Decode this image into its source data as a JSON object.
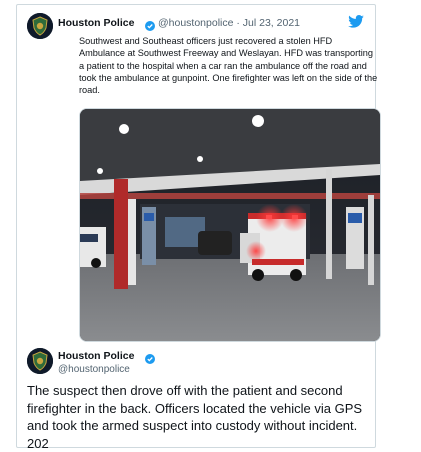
{
  "tweet1": {
    "name": "Houston Police",
    "handle_date": "@houstonpolice · Jul 23, 2021",
    "text": "Southwest and Southeast officers just recovered a stolen HFD Ambulance at Southwest Freeway and Weslayan. HFD was transporting a patient to the hospital when a car ran the ambulance off the road and took the ambulance at gunpoint. One firefighter was left on the side of the road."
  },
  "tweet2": {
    "name": "Houston Police",
    "handle": "@houstonpolice",
    "text": "The suspect then drove off with the patient and second firefighter in the back. Officers located the vehicle via GPS and took the armed suspect into custody without incident.",
    "count": "202"
  },
  "icons": {
    "avatar": "houston-police-badge-icon",
    "verified": "verified-badge-icon",
    "brand": "twitter-bird-icon"
  },
  "colors": {
    "verified": "#1d9bf0",
    "brand": "#1d9bf0"
  }
}
